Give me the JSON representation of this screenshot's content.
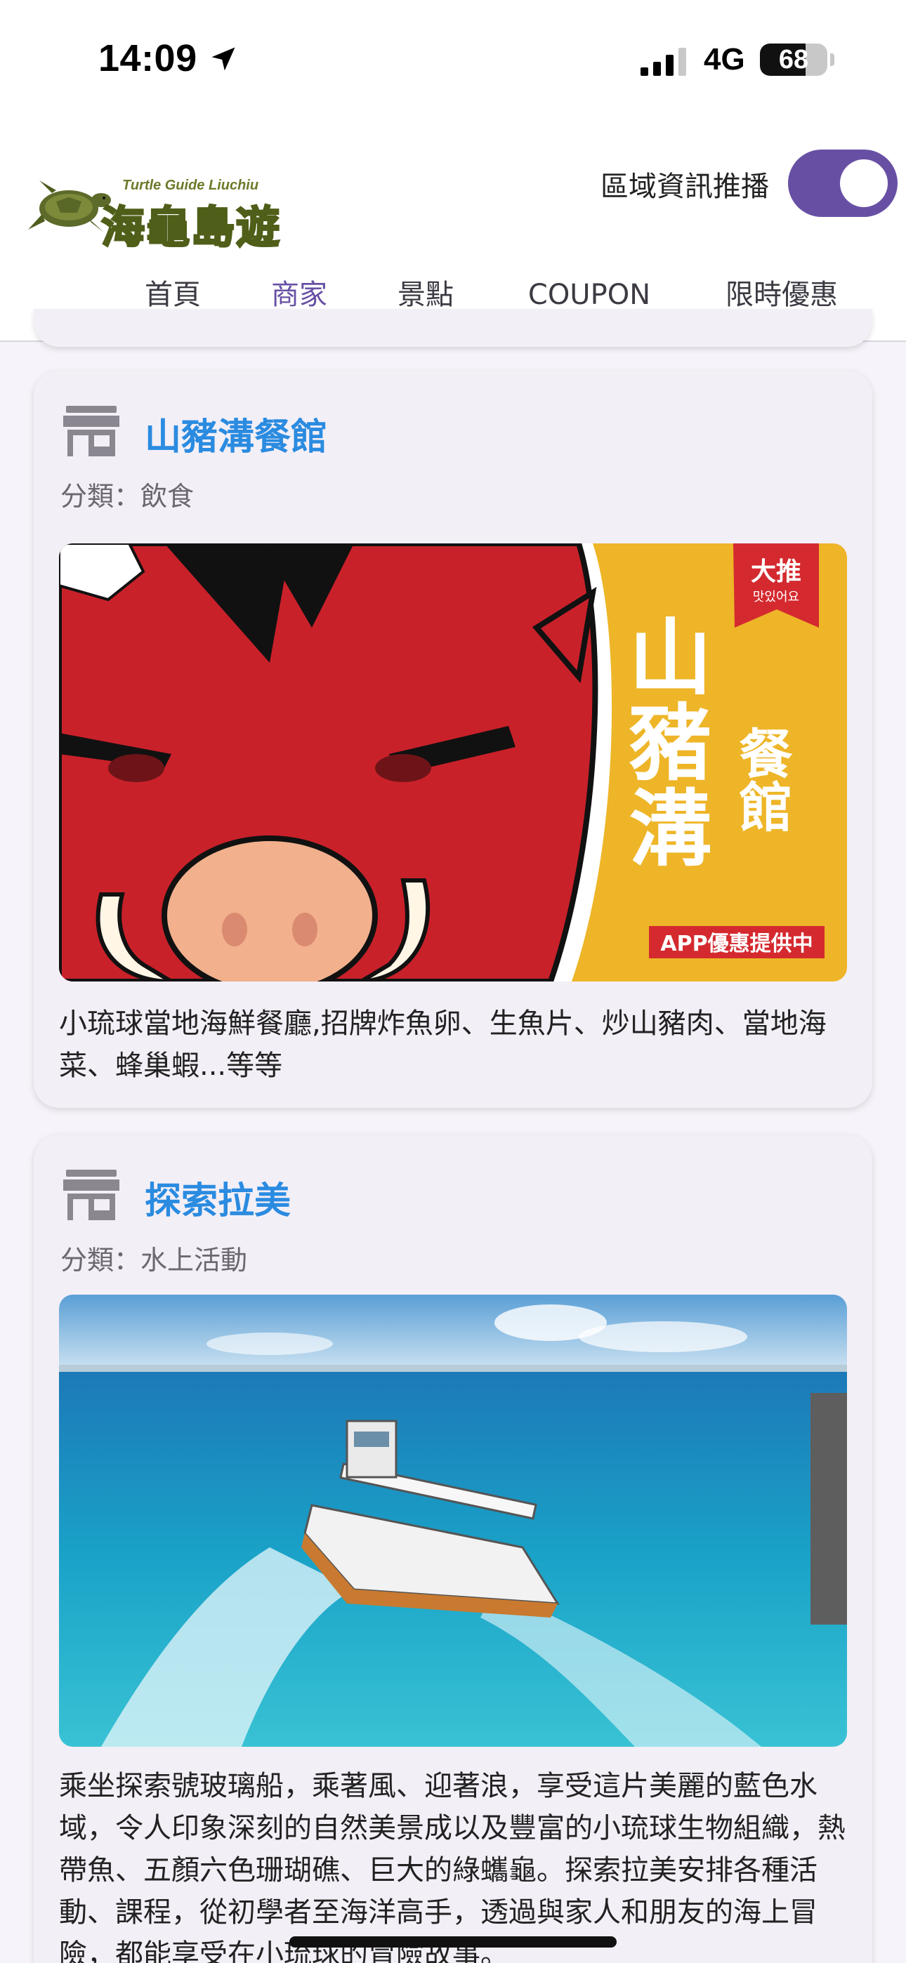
{
  "status_bar": {
    "time": "14:09",
    "network": "4G",
    "battery": "68",
    "battery_level": 0.68,
    "icons": [
      "location-arrow-icon",
      "cellular-signal-icon",
      "battery-icon"
    ]
  },
  "header": {
    "logo_subtitle": "Turtle Guide Liuchiu",
    "logo_title": "海龜島遊",
    "push_toggle_label": "區域資訊推播",
    "push_toggle_on": true,
    "accent_color": "#6750a4",
    "tabs": [
      {
        "label": "首頁",
        "active": false
      },
      {
        "label": "商家",
        "active": true
      },
      {
        "label": "景點",
        "active": false
      },
      {
        "label": "COUPON",
        "active": false
      },
      {
        "label": "限時優惠",
        "active": false
      }
    ]
  },
  "merchants": [
    {
      "icon": "store-icon",
      "name": "山豬溝餐館",
      "category": "分類：飲食",
      "image": {
        "ribbon_main": "大推",
        "ribbon_sub": "맛있어요",
        "sign_big": "山豬溝",
        "sign_side": "餐館",
        "badge": "APP優惠提供中"
      },
      "description": "小琉球當地海鮮餐廳,招牌炸魚卵、生魚片、炒山豬肉、當地海菜、蜂巢蝦...等等"
    },
    {
      "icon": "store-icon",
      "name": "探索拉美",
      "category": "分類：水上活動",
      "description": "乘坐探索號玻璃船，乘著風、迎著浪，享受這片美麗的藍色水域，令人印象深刻的自然美景成以及豐富的小琉球生物組織，熱帶魚、五顏六色珊瑚礁、巨大的綠蠵龜。探索拉美安排各種活動、課程，從初學者至海洋高手，透過與家人和朋友的海上冒險，都能享受在小琉球的冒險故事。"
    }
  ]
}
